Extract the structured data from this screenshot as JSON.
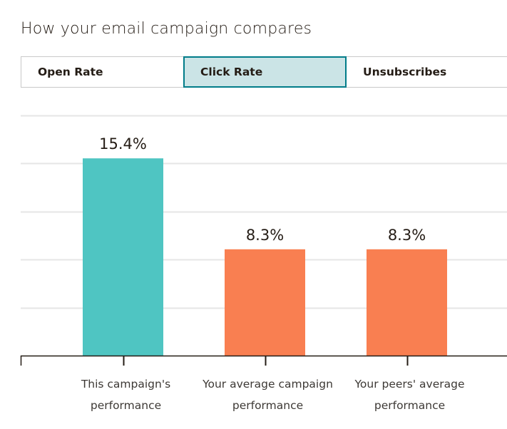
{
  "header": {
    "title": "How your email campaign compares"
  },
  "tabs": [
    {
      "label": "Open Rate",
      "active": false
    },
    {
      "label": "Click Rate",
      "active": true
    },
    {
      "label": "Unsubscribes",
      "active": false
    }
  ],
  "colors": {
    "teal": "#4fc5c2",
    "orange": "#f97f51",
    "active_tab_bg": "#cbe4e6",
    "active_tab_border": "#007c89"
  },
  "chart_data": {
    "type": "bar",
    "title": "How your email campaign compares",
    "metric": "Click Rate",
    "categories": [
      [
        "This campaign's",
        "performance"
      ],
      [
        "Your average campaign",
        "performance"
      ],
      [
        "Your peers' average",
        "performance"
      ]
    ],
    "values": [
      15.4,
      8.3,
      8.3
    ],
    "value_labels": [
      "15.4%",
      "8.3%",
      "8.3%"
    ],
    "bar_colors": [
      "#4fc5c2",
      "#f97f51",
      "#f97f51"
    ],
    "xlabel": "",
    "ylabel": "",
    "ylim": [
      0,
      18.75
    ],
    "grid": true,
    "grid_step": 3.75
  }
}
